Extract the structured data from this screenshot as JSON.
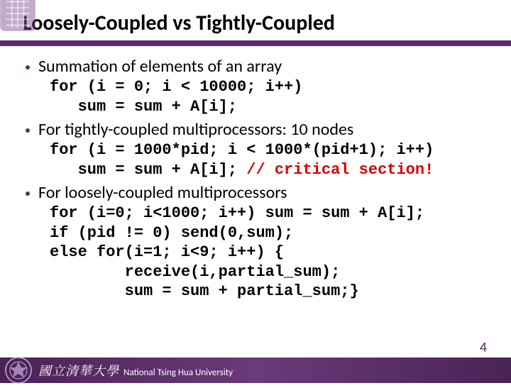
{
  "title": "Loosely-Coupled vs Tightly-Coupled",
  "bullets": [
    {
      "text": "Summation of elements of an array",
      "code_lines": [
        "for (i = 0; i < 10000; i++)",
        "   sum = sum + A[i];"
      ]
    },
    {
      "text": "For tightly-coupled multiprocessors: 10 nodes",
      "code_lines": [
        "for (i = 1000*pid; i < 1000*(pid+1); i++)"
      ],
      "code_mixed": {
        "prefix": "   sum = sum + A[i]; ",
        "red": "// critical section!"
      }
    },
    {
      "text": "For loosely-coupled multiprocessors",
      "code_lines": [
        "for (i=0; i<1000; i++) sum = sum + A[i];",
        "if (pid != 0) send(0,sum);",
        "else for(i=1; i<9; i++) {",
        "        receive(i,partial_sum);",
        "        sum = sum + partial_sum;}"
      ]
    }
  ],
  "footer": {
    "chinese": "國立清華大學",
    "english": "National Tsing Hua University"
  },
  "page_number": "4"
}
